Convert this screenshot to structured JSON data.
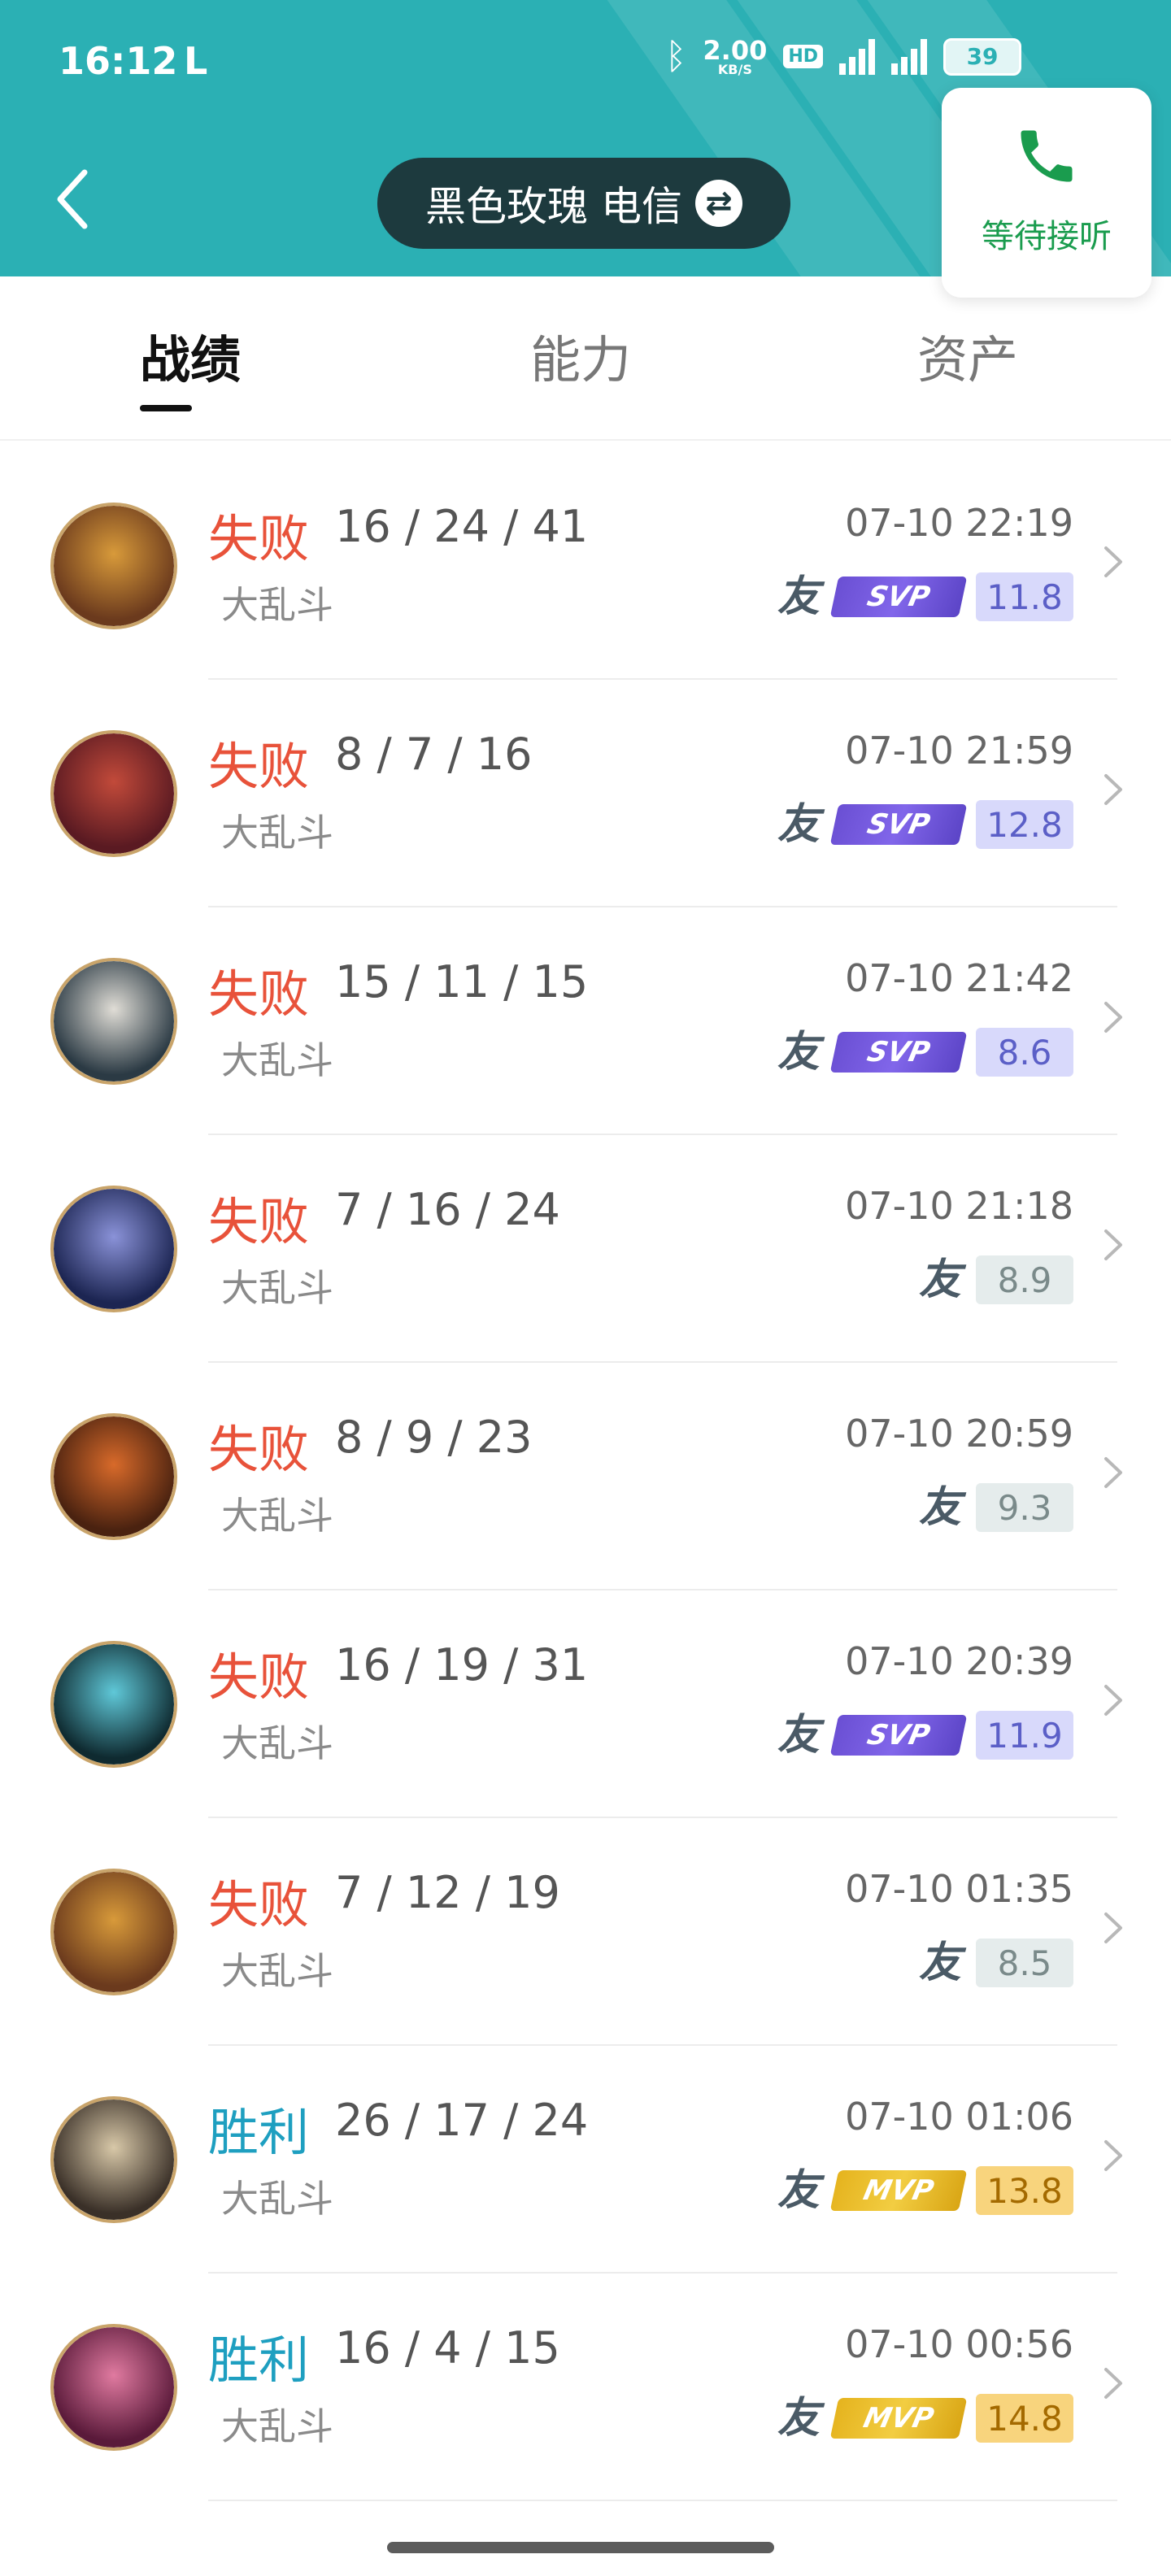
{
  "status_bar": {
    "time": "16:12",
    "carrier_mark": "L",
    "net_speed_value": "2.00",
    "net_speed_unit": "KB/S",
    "hd_label": "HD",
    "battery": "39"
  },
  "header": {
    "account_name": "黑色玫瑰 电信",
    "account_switch_icon": "swap-icon",
    "call_label": "等待接听",
    "colors": {
      "header_bg": "#2bb0b4",
      "pill_bg": "#1d3a3e",
      "call_green": "#1a9c4e"
    }
  },
  "tabs": [
    {
      "label": "战绩",
      "active": true
    },
    {
      "label": "能力",
      "active": false
    },
    {
      "label": "资产",
      "active": false
    }
  ],
  "matches": [
    {
      "result": "失败",
      "outcome": "lose",
      "kda": "16 / 24 / 41",
      "datetime": "07-10 22:19",
      "mode": "大乱斗",
      "badge": "SVP",
      "score": "11.8",
      "avatar_colors": [
        "#6b3a1d",
        "#d89a3a"
      ]
    },
    {
      "result": "失败",
      "outcome": "lose",
      "kda": "8 / 7 / 16",
      "datetime": "07-10 21:59",
      "mode": "大乱斗",
      "badge": "SVP",
      "score": "12.8",
      "avatar_colors": [
        "#5a1a22",
        "#c24a3a"
      ]
    },
    {
      "result": "失败",
      "outcome": "lose",
      "kda": "15 / 11 / 15",
      "datetime": "07-10 21:42",
      "mode": "大乱斗",
      "badge": "SVP",
      "score": "8.6",
      "avatar_colors": [
        "#2b3a44",
        "#e0ddd6"
      ]
    },
    {
      "result": "失败",
      "outcome": "lose",
      "kda": "7 / 16 / 24",
      "datetime": "07-10 21:18",
      "mode": "大乱斗",
      "badge": "",
      "score": "8.9",
      "avatar_colors": [
        "#1c2552",
        "#8a92d8"
      ]
    },
    {
      "result": "失败",
      "outcome": "lose",
      "kda": "8 / 9 / 23",
      "datetime": "07-10 20:59",
      "mode": "大乱斗",
      "badge": "",
      "score": "9.3",
      "avatar_colors": [
        "#4a2210",
        "#d86a2a"
      ]
    },
    {
      "result": "失败",
      "outcome": "lose",
      "kda": "16 / 19 / 31",
      "datetime": "07-10 20:39",
      "mode": "大乱斗",
      "badge": "SVP",
      "score": "11.9",
      "avatar_colors": [
        "#0f2a30",
        "#5fc8d8"
      ]
    },
    {
      "result": "失败",
      "outcome": "lose",
      "kda": "7 / 12 / 19",
      "datetime": "07-10 01:35",
      "mode": "大乱斗",
      "badge": "",
      "score": "8.5",
      "avatar_colors": [
        "#6b3a1d",
        "#d89a3a"
      ]
    },
    {
      "result": "胜利",
      "outcome": "win",
      "kda": "26 / 17 / 24",
      "datetime": "07-10 01:06",
      "mode": "大乱斗",
      "badge": "MVP",
      "score": "13.8",
      "avatar_colors": [
        "#3a3028",
        "#d8c8a8"
      ]
    },
    {
      "result": "胜利",
      "outcome": "win",
      "kda": "16 / 4 / 15",
      "datetime": "07-10 00:56",
      "mode": "大乱斗",
      "badge": "MVP",
      "score": "14.8",
      "avatar_colors": [
        "#5a1a3a",
        "#e07aa0"
      ]
    }
  ],
  "friend_mark": "友",
  "icons": {
    "back": "back-arrow-icon",
    "phone": "phone-icon",
    "chevron": "chevron-right-icon"
  }
}
